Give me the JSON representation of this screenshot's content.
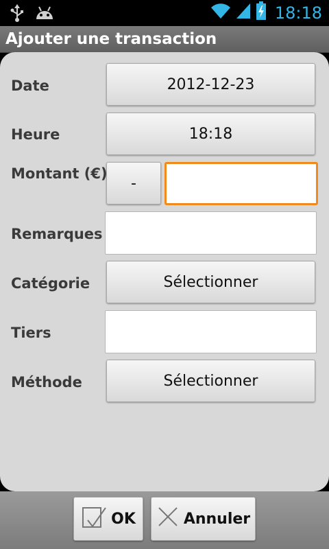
{
  "status_bar": {
    "time": "18:18",
    "icons": [
      "usb-icon",
      "android-icon",
      "wifi-icon",
      "signal-icon",
      "battery-charging-icon"
    ],
    "accent_color": "#33b5e5"
  },
  "title_bar": {
    "title": "Ajouter une transaction"
  },
  "form": {
    "date": {
      "label": "Date",
      "value": "2012-12-23"
    },
    "time": {
      "label": "Heure",
      "value": "18:18"
    },
    "amount": {
      "label": "Montant (€)",
      "sign": "-",
      "value": ""
    },
    "notes": {
      "label": "Remarques",
      "value": ""
    },
    "category": {
      "label": "Catégorie",
      "value": "Sélectionner"
    },
    "payee": {
      "label": "Tiers",
      "value": ""
    },
    "method": {
      "label": "Méthode",
      "value": "Sélectionner"
    }
  },
  "actions": {
    "ok_label": "OK",
    "cancel_label": "Annuler"
  },
  "colors": {
    "focus": "#f08a1c"
  }
}
